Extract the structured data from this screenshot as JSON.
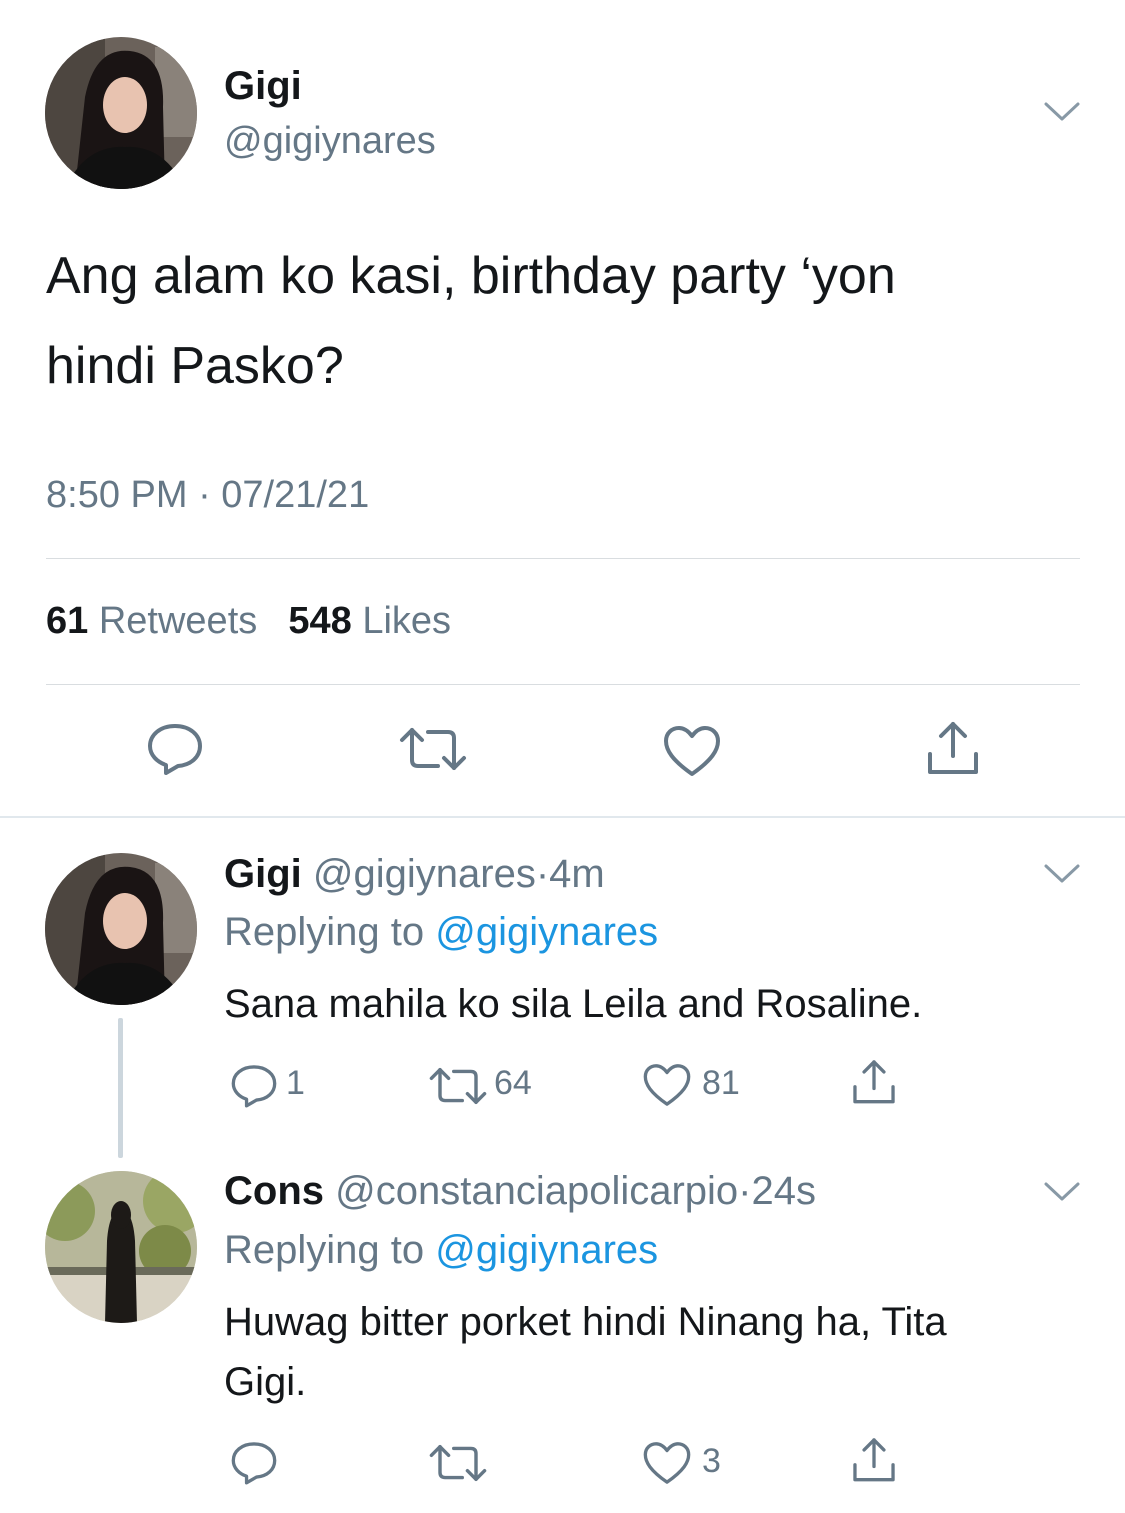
{
  "main_tweet": {
    "display_name": "Gigi",
    "handle": "@gigiynares",
    "text_line1": "Ang alam ko kasi, birthday party ‘yon",
    "text_line2": "hindi Pasko?",
    "timestamp": "8:50 PM · 07/21/21",
    "retweet_count": "61",
    "retweet_label": "Retweets",
    "like_count": "548",
    "like_label": "Likes",
    "icons": [
      "chevron-down-icon",
      "reply-icon",
      "retweet-icon",
      "like-icon",
      "share-icon"
    ]
  },
  "replies": [
    {
      "display_name": "Gigi",
      "handle": "@gigiynares",
      "time": "4m",
      "replying_prefix": "Replying to",
      "replying_to": "@gigiynares",
      "text": "Sana mahila ko sila Leila and Rosaline.",
      "reply_count": "1",
      "retweet_count": "64",
      "like_count": "81"
    },
    {
      "display_name": "Cons",
      "handle": "@constanciapolicarpio",
      "time": "24s",
      "replying_prefix": "Replying to",
      "replying_to": "@gigiynares",
      "text_line1": "Huwag bitter porket hindi Ninang ha, Tita",
      "text_line2": "Gigi.",
      "like_count": "3"
    }
  ],
  "colors": {
    "text": "#14171a",
    "secondary": "#657786",
    "link": "#1b95e0",
    "divider": "#e1e8ed",
    "thread_line": "#ccd6dd"
  }
}
